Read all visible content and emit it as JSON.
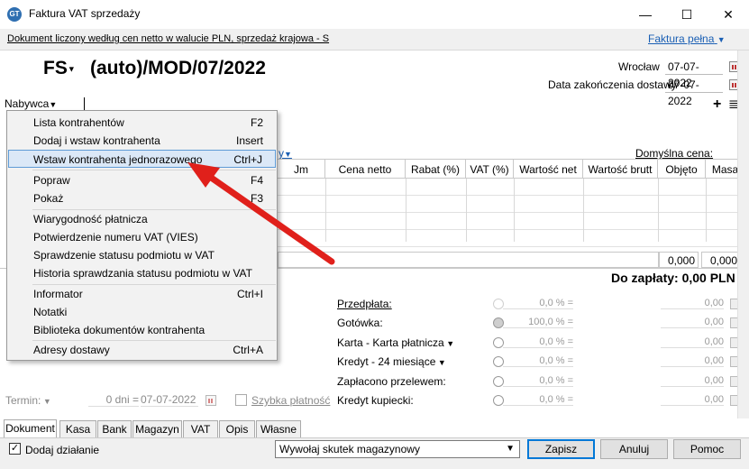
{
  "window": {
    "title": "Faktura VAT sprzedaży",
    "minimize_glyph": "—",
    "maximize_glyph": "☐",
    "close_glyph": "✕"
  },
  "infobar": {
    "text": "Dokument liczony według cen netto w walucie PLN, sprzedaż krajowa - S",
    "invoice_type": "Faktura pełna"
  },
  "document": {
    "type": "FS",
    "number": "(auto)/MOD/07/2022",
    "place": "Wrocław",
    "issue_date": "07-07-2022",
    "delivery_label": "Data zakończenia dostawy",
    "delivery_date": "07-07-2022"
  },
  "buyer": {
    "label": "Nabywca",
    "add_glyph": "+",
    "list_glyph": "≣"
  },
  "grid": {
    "partial_link": "y",
    "default_price_label": "Domyślna cena: Hurtowa",
    "columns": [
      "Jm",
      "Cena netto",
      "Rabat (%)",
      "VAT (%)",
      "Wartość net",
      "Wartość brutt",
      "Objęto",
      "Masa"
    ],
    "sum_volume": "0,000",
    "sum_mass": "0,000"
  },
  "total": "Do zapłaty: 0,00 PLN",
  "payments": [
    {
      "label": "Przedpłata:",
      "pct": "0,0 % =",
      "amount": "0,00"
    },
    {
      "label": "Gotówka:",
      "pct": "100,0 % =",
      "amount": "0,00"
    },
    {
      "label": "Karta - Karta płatnicza",
      "pct": "0,0 % =",
      "amount": "0,00"
    },
    {
      "label": "Kredyt - 24 miesiące",
      "pct": "0,0 % =",
      "amount": "0,00"
    },
    {
      "label": "Zapłacono przelewem:",
      "pct": "0,0 % =",
      "amount": "0,00"
    },
    {
      "label": "Kredyt kupiecki:",
      "pct": "0,0 % =",
      "amount": "0,00"
    }
  ],
  "term": {
    "label": "Termin:",
    "days": "0 dni =",
    "date": "07-07-2022",
    "quick_pay": "Szybka płatność"
  },
  "tabs": [
    "Dokument",
    "Kasa",
    "Bank",
    "Magazyn",
    "VAT",
    "Opis",
    "Własne"
  ],
  "bottom": {
    "add_action": "Dodaj działanie",
    "warehouse_effect": "Wywołaj skutek magazynowy",
    "save": "Zapisz",
    "cancel": "Anuluj",
    "help": "Pomoc"
  },
  "context_menu": [
    {
      "label": "Lista kontrahentów",
      "shortcut": "F2"
    },
    {
      "label": "Dodaj i wstaw kontrahenta",
      "shortcut": "Insert"
    },
    {
      "label": "Wstaw kontrahenta jednorazowego",
      "shortcut": "Ctrl+J"
    },
    {
      "label": "Popraw",
      "shortcut": "F4"
    },
    {
      "label": "Pokaż",
      "shortcut": "F3"
    },
    {
      "label": "Wiarygodność płatnicza",
      "shortcut": ""
    },
    {
      "label": "Potwierdzenie numeru VAT (VIES)",
      "shortcut": ""
    },
    {
      "label": "Sprawdzenie statusu podmiotu w VAT",
      "shortcut": ""
    },
    {
      "label": "Historia sprawdzania statusu podmiotu w VAT",
      "shortcut": ""
    },
    {
      "label": "Informator",
      "shortcut": "Ctrl+I"
    },
    {
      "label": "Notatki",
      "shortcut": ""
    },
    {
      "label": "Biblioteka dokumentów kontrahenta",
      "shortcut": ""
    },
    {
      "label": "Adresy dostawy",
      "shortcut": "Ctrl+A"
    }
  ],
  "colors": {
    "accent": "#0078d7",
    "link": "#1a5fb4",
    "annotation_arrow": "#e0201b"
  }
}
